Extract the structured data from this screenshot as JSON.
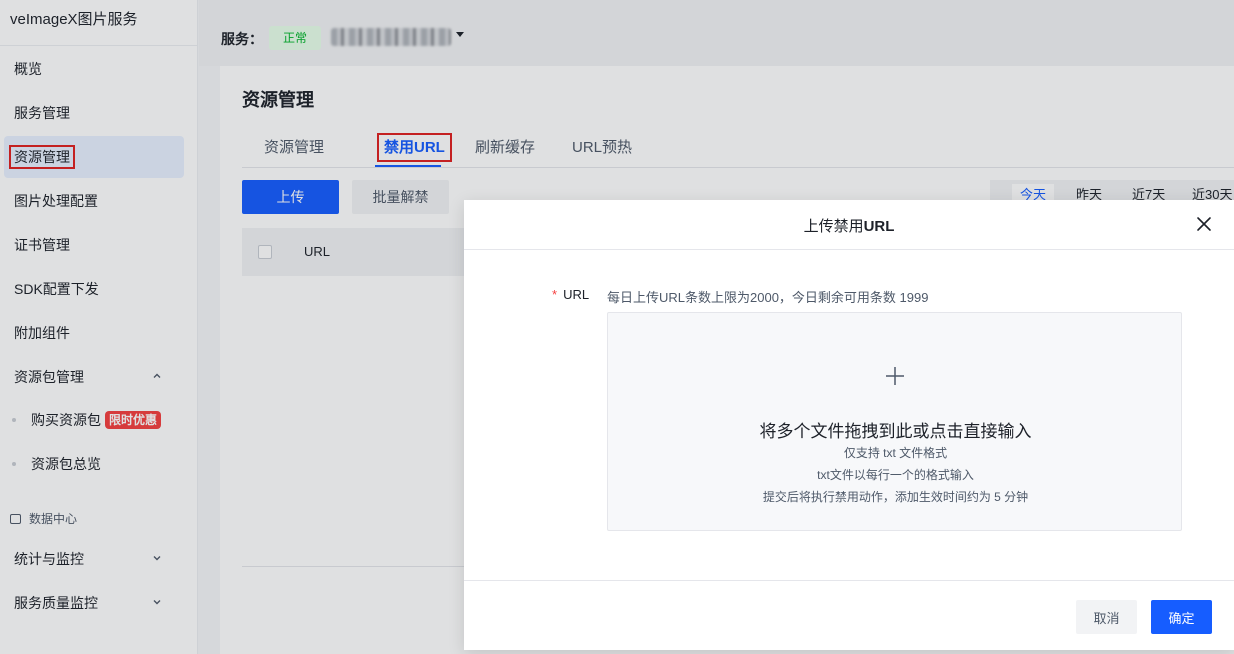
{
  "sidebar": {
    "brand": "veImageX图片服务",
    "items": [
      {
        "label": "概览"
      },
      {
        "label": "服务管理"
      },
      {
        "label": "资源管理"
      },
      {
        "label": "图片处理配置"
      },
      {
        "label": "证书管理"
      },
      {
        "label": "SDK配置下发"
      },
      {
        "label": "附加组件"
      },
      {
        "label": "资源包管理",
        "chevron": "chevron-up-icon"
      }
    ],
    "sub_items": [
      {
        "label": "购买资源包",
        "badge": "限时优惠"
      },
      {
        "label": "资源包总览"
      }
    ],
    "data_center": {
      "title": "数据中心",
      "items": [
        {
          "label": "统计与监控",
          "chevron": "chevron-down-icon"
        },
        {
          "label": "服务质量监控",
          "chevron": "chevron-down-icon"
        }
      ]
    }
  },
  "topbar": {
    "service_label": "服务：",
    "service_status": "正常"
  },
  "main": {
    "title": "资源管理",
    "tabs": [
      {
        "label": "资源管理"
      },
      {
        "label": "禁用URL"
      },
      {
        "label": "刷新缓存"
      },
      {
        "label": "URL预热"
      }
    ],
    "upload_label": "上传",
    "batch_unban_label": "批量解禁",
    "date_filters": [
      "今天",
      "昨天",
      "近7天",
      "近30天"
    ],
    "table": {
      "columns": [
        "URL"
      ]
    }
  },
  "modal": {
    "title_prefix": "上传禁用",
    "title_suffix": "URL",
    "field_label": "URL",
    "required_mark": "*",
    "hint": "每日上传URL条数上限为2000，今日剩余可用条数 1999",
    "dropzone": {
      "title": "将多个文件拖拽到此或点击直接输入",
      "lines": [
        "仅支持 txt 文件格式",
        "txt文件以每行一个的格式输入",
        "提交后将执行禁用动作，添加生效时间约为 5 分钟"
      ]
    },
    "cancel_label": "取消",
    "confirm_label": "确定"
  },
  "colors": {
    "primary": "#165dff",
    "success": "#00b42a",
    "danger": "#f53f3f",
    "highlight_box": "#e02020"
  }
}
